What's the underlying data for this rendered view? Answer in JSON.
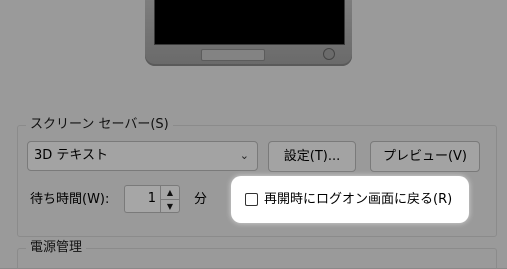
{
  "screensaver_group": {
    "label": "スクリーン セーバー(S)",
    "selected": "3D テキスト",
    "settings_button": "設定(T)...",
    "preview_button": "プレビュー(V)",
    "wait_label": "待ち時間(W):",
    "wait_value": "1",
    "wait_unit": "分",
    "resume_checkbox_label": "再開時にログオン画面に戻る(R)",
    "resume_checked": false
  },
  "power_group": {
    "label": "電源管理"
  },
  "colors": {
    "highlight": "#ffffff",
    "dim_background": "#9a9a9a"
  }
}
